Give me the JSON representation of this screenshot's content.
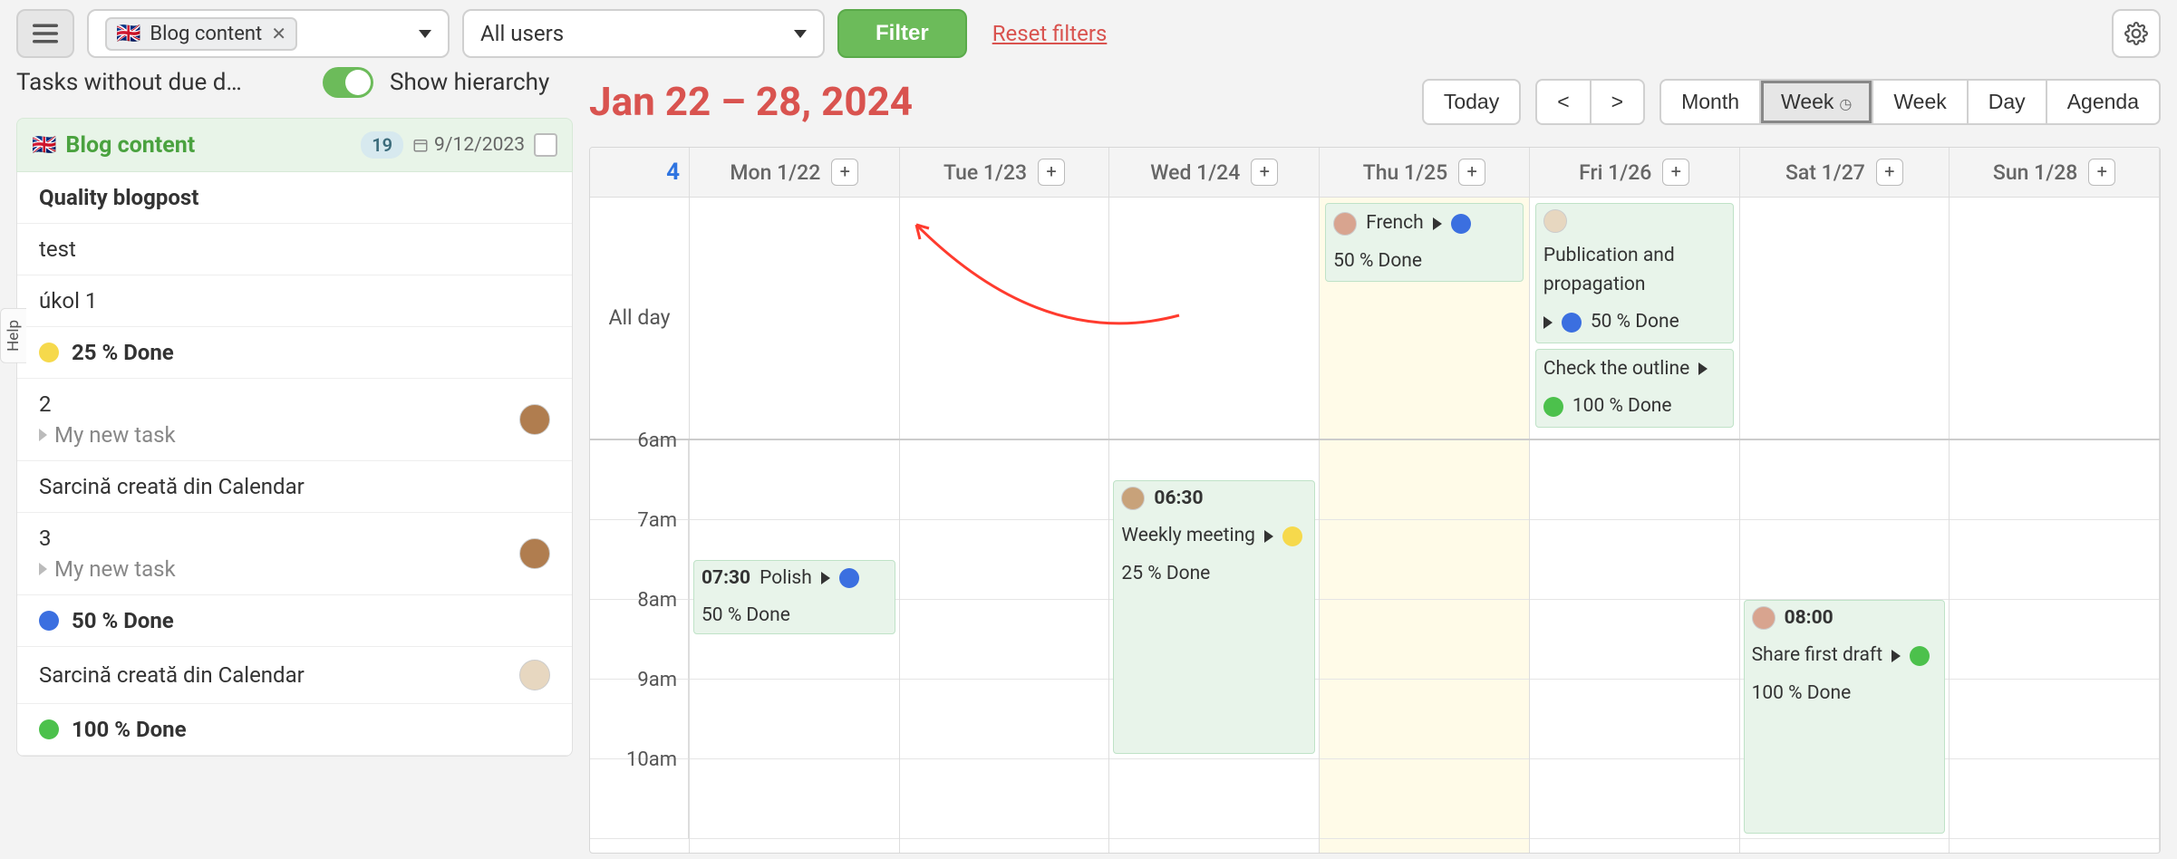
{
  "topbar": {
    "project_tag": "Blog content",
    "users_select": "All users",
    "filter_btn": "Filter",
    "reset_link": "Reset filters"
  },
  "header": {
    "tasks_label": "Tasks without due d…",
    "show_hierarchy": "Show hierarchy"
  },
  "help_tab": "Help",
  "sidebar": {
    "project_name": "Blog content",
    "count": "19",
    "date": "9/12/2023",
    "items": [
      {
        "type": "heading",
        "label": "Quality blogpost"
      },
      {
        "type": "task",
        "label": "test"
      },
      {
        "type": "task",
        "label": "úkol 1"
      },
      {
        "type": "status",
        "color": "yellow",
        "label": "25 % Done"
      },
      {
        "type": "task-sub",
        "label": "2",
        "sub": "My new task",
        "avatar": "brown"
      },
      {
        "type": "task",
        "label": "Sarcină creată din Calendar"
      },
      {
        "type": "task-sub",
        "label": "3",
        "sub": "My new task",
        "avatar": "brown"
      },
      {
        "type": "status",
        "color": "blue",
        "label": "50 % Done"
      },
      {
        "type": "task",
        "label": "Sarcină creată din Calendar",
        "avatar": "dog"
      },
      {
        "type": "status",
        "color": "green",
        "label": "100 % Done"
      }
    ]
  },
  "calendar": {
    "title": "Jan 22 – 28, 2024",
    "nav": {
      "today": "Today",
      "prev": "<",
      "next": ">",
      "views": [
        {
          "id": "month",
          "label": "Month",
          "active": false
        },
        {
          "id": "week-clock",
          "label": "Week",
          "clock": true,
          "active": true
        },
        {
          "id": "week",
          "label": "Week",
          "active": false
        },
        {
          "id": "day",
          "label": "Day",
          "active": false
        },
        {
          "id": "agenda",
          "label": "Agenda",
          "active": false
        }
      ]
    },
    "week_no": "4",
    "days": [
      {
        "id": "mon",
        "label": "Mon 1/22"
      },
      {
        "id": "tue",
        "label": "Tue 1/23"
      },
      {
        "id": "wed",
        "label": "Wed 1/24"
      },
      {
        "id": "thu",
        "label": "Thu 1/25"
      },
      {
        "id": "fri",
        "label": "Fri 1/26"
      },
      {
        "id": "sat",
        "label": "Sat 1/27"
      },
      {
        "id": "sun",
        "label": "Sun 1/28"
      }
    ],
    "allday_label": "All day",
    "allday": {
      "thu": [
        {
          "avatar": "man",
          "title": "French",
          "color": "blue",
          "status": "50 % Done"
        }
      ],
      "fri": [
        {
          "avatar": "dog",
          "title": "Publication and propagation",
          "color": "blue",
          "status": "50 % Done"
        },
        {
          "title": "Check the outline",
          "color": "green",
          "status": "100 % Done"
        }
      ]
    },
    "hours": [
      "6am",
      "7am",
      "8am",
      "9am",
      "10am"
    ],
    "timed": {
      "mon": [
        {
          "time": "07:30",
          "title": "Polish",
          "color": "blue",
          "status": "50 % Done",
          "top_hour": 1.5,
          "dur": 1
        }
      ],
      "wed": [
        {
          "avatar": "brown",
          "time": "06:30",
          "title": "Weekly meeting",
          "color": "yellow",
          "status": "25 % Done",
          "top_hour": 0.5,
          "dur": 3.5
        }
      ],
      "sat": [
        {
          "avatar": "man",
          "time": "08:00",
          "title": "Share first draft",
          "color": "green",
          "status": "100 % Done",
          "top_hour": 2,
          "dur": 3
        }
      ]
    }
  }
}
